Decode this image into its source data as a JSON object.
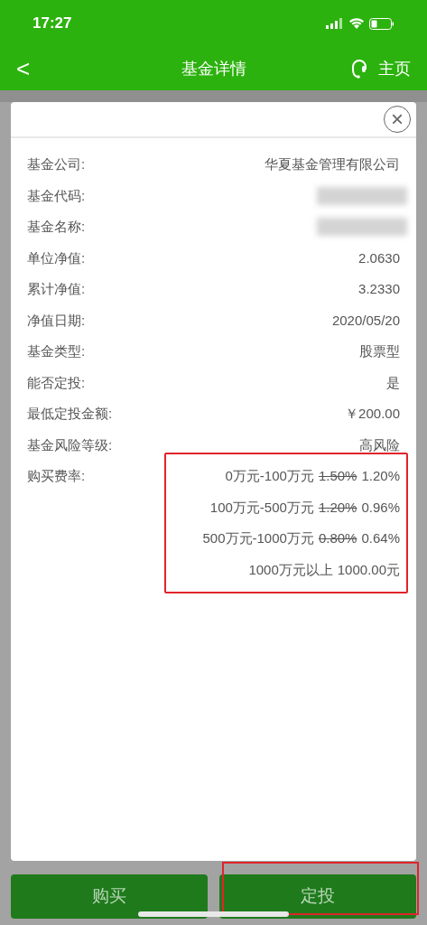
{
  "status_bar": {
    "time": "17:27"
  },
  "nav": {
    "back": "<",
    "title": "基金详情",
    "home": "主页"
  },
  "dialog": {
    "close": "×",
    "rows": [
      {
        "label": "基金公司:",
        "value": "华夏基金管理有限公司"
      },
      {
        "label": "基金代码:",
        "redacted": true
      },
      {
        "label": "基金名称:",
        "redacted": true
      },
      {
        "label": "单位净值:",
        "value": "2.0630"
      },
      {
        "label": "累计净值:",
        "value": "3.2330"
      },
      {
        "label": "净值日期:",
        "value": "2020/05/20"
      },
      {
        "label": "基金类型:",
        "value": "股票型"
      },
      {
        "label": "能否定投:",
        "value": "是"
      },
      {
        "label": "最低定投金额:",
        "value": "￥200.00"
      },
      {
        "label": "基金风险等级:",
        "value": "高风险"
      }
    ],
    "fee_label": "购买费率:",
    "fee_tiers": [
      {
        "range": "0万元-100万元",
        "original_rate": "1.50%",
        "rate": "1.20%"
      },
      {
        "range": "100万元-500万元",
        "original_rate": "1.20%",
        "rate": "0.96%"
      },
      {
        "range": "500万元-1000万元",
        "original_rate": "0.80%",
        "rate": "0.64%"
      },
      {
        "range": "1000万元以上",
        "rate": "1000.00元"
      }
    ]
  },
  "buttons": [
    {
      "label": "购买",
      "highlighted": false
    },
    {
      "label": "定投",
      "highlighted": true
    }
  ]
}
